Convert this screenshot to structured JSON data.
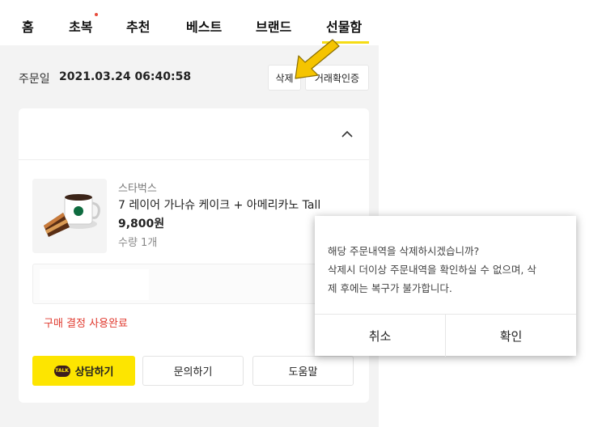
{
  "tabs": [
    {
      "label": "홈",
      "new": false
    },
    {
      "label": "초복",
      "new": true
    },
    {
      "label": "추천",
      "new": false
    },
    {
      "label": "베스트",
      "new": false
    },
    {
      "label": "브랜드",
      "new": false
    },
    {
      "label": "선물함",
      "new": false,
      "active": true
    }
  ],
  "order": {
    "date_label": "주문일",
    "date_value": "2021.03.24 06:40:58",
    "delete_label": "삭제",
    "receipt_label": "거래확인증"
  },
  "product": {
    "brand": "스타벅스",
    "name": "7 레이어 가나슈 케이크 + 아메리카노 Tall",
    "price": "9,800원",
    "qty": "수량 1개"
  },
  "status": "구매 결정 사용완료",
  "actions": {
    "chat_label": "상담하기",
    "chat_icon_text": "TALK",
    "inquiry_label": "문의하기",
    "help_label": "도움말"
  },
  "dialog": {
    "line1": "해당 주문내역을 삭제하시겠습니까?",
    "line2": "삭제시 더이상 주문내역을 확인하실 수 없으며, 삭",
    "line3": "제 후에는 복구가 불가합니다.",
    "cancel_label": "취소",
    "confirm_label": "확인"
  },
  "colors": {
    "accent_yellow": "#fde500",
    "status_red": "#e03a2f",
    "arrow_yellow": "#f5c400"
  }
}
